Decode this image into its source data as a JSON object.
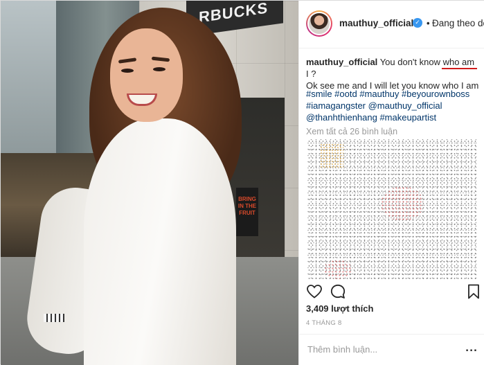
{
  "photo": {
    "sign_text": "RBUCKS",
    "poster_text": "BRING IN THE FRUIT"
  },
  "post": {
    "username": "mauthuy_official",
    "verified_icon": "verified-badge-icon",
    "separator": "•",
    "follow_status": "Đang theo dõi"
  },
  "caption": {
    "username": "mauthuy_official",
    "text_before": "You don't know ",
    "highlight": "who am",
    "text_after": " I ?",
    "line2": "Ok see me and I will let you know who I am",
    "tags": "#smile #ootd #mauthuy #beyourownboss #iamagangster @mauthuy_official @thanhthienhang #makeupartist"
  },
  "comments": {
    "view_all": "Xem tất cả 26 bình luận"
  },
  "actions": {
    "like_icon": "heart-icon",
    "comment_icon": "comment-icon",
    "save_icon": "bookmark-icon"
  },
  "likes": "3,409 lượt thích",
  "date": "4 THÁNG 8",
  "comment_input": {
    "placeholder": "Thêm bình luận...",
    "options": "..."
  },
  "colors": {
    "accent_blue": "#3897f0",
    "link_blue": "#003569",
    "underline_red": "#d11c1c"
  }
}
